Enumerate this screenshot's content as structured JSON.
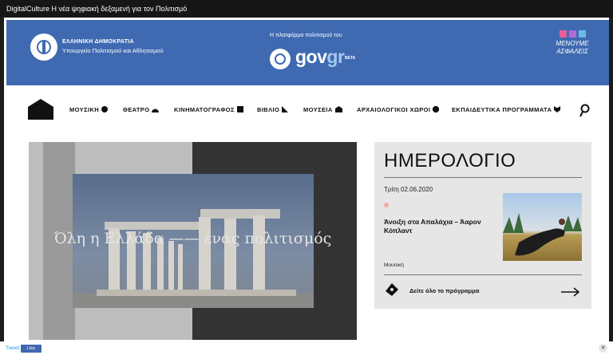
{
  "window": {
    "title": "DigitalCulture Η νέα ψηφιακή δεξαμενή για τον Πολιτισμό"
  },
  "gov_header": {
    "republic": "ΕΛΛΗΝΙΚΗ ΔΗΜΟΚΡΑΤΙΑ",
    "ministry": "Υπουργείο Πολιτισμού και Αθλητισμού",
    "platform_label": "Η πλατφόρμα πολιτισμού του",
    "brand_a": "gov",
    "brand_b": "gr",
    "beta": "BETA",
    "menoume": "ΜΕΝΟΥΜΕ ΑΣΦΑΛΕΙΣ"
  },
  "nav": {
    "items": [
      {
        "label": "ΜΟΥΣΙΚΗ"
      },
      {
        "label": "ΘΕΑΤΡΟ"
      },
      {
        "label": "ΚΙΝΗΜΑΤΟΓΡΑΦΟΣ"
      },
      {
        "label": "ΒΙΒΛΙΟ"
      },
      {
        "label": "ΜΟΥΣΕΙΑ"
      },
      {
        "label": "ΑΡΧΑΙΟΛΟΓΙΚΟΙ ΧΩΡΟΙ"
      },
      {
        "label": "ΕΚΠΑΙΔΕΥΤΙΚΑ ΠΡΟΓΡΑΜΜΑΤΑ"
      }
    ]
  },
  "hero": {
    "caption": "Όλη η Ελλάδα —— ένας πολιτισμός"
  },
  "calendar": {
    "title": "ΗΜΕΡΟΛΟΓΙΟ",
    "date": "Τρίτη 02.06.2020",
    "event_title": "Άνοιξη στα Απαλάχια – Άαρον Κόπλαντ",
    "category": "Μουσική",
    "program_link": "Δείτε όλο το πρόγραμμα"
  },
  "footer": {
    "tweet": "Tweet",
    "like": "Like",
    "close": "✕"
  },
  "colors": {
    "gov_blue": "#3f6ab1",
    "calendar_bg": "#e6e6e6",
    "accent_dot": "#f3a9a2"
  }
}
